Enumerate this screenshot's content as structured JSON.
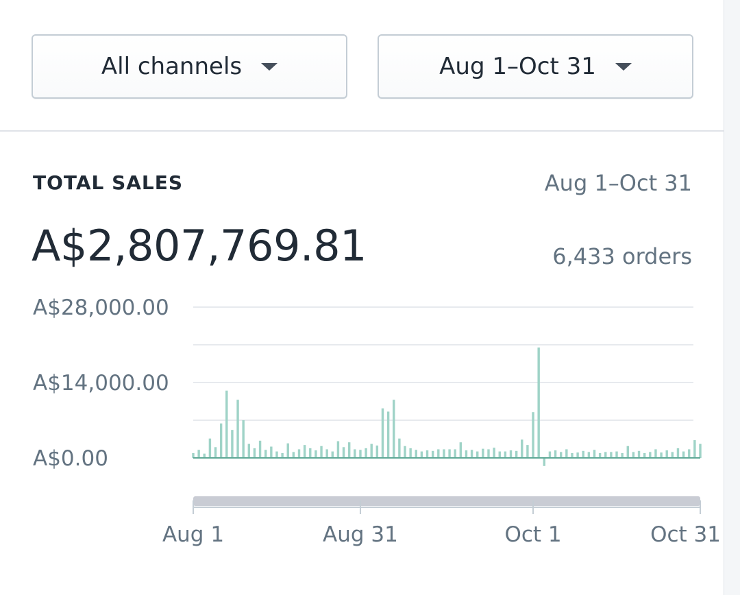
{
  "filters": {
    "channels_label": "All channels",
    "date_label": "Aug 1–Oct 31"
  },
  "card": {
    "title": "TOTAL SALES",
    "range": "Aug 1–Oct 31",
    "total": "A$2,807,769.81",
    "orders": "6,433 orders"
  },
  "colors": {
    "bar": "#9fd3c7",
    "bar_dark": "#5fa896",
    "grid": "#dfe3e8",
    "axis": "#c4cdd5"
  },
  "chart_data": {
    "type": "bar",
    "title": "",
    "xlabel": "",
    "ylabel": "",
    "y_ticks": [
      {
        "value": 28000,
        "label": "A$28,000.00"
      },
      {
        "value": 14000,
        "label": "A$14,000.00"
      },
      {
        "value": 0,
        "label": "A$0.00"
      }
    ],
    "ylim": [
      -4000,
      28000
    ],
    "x_ticks": [
      {
        "day_index": 0,
        "label": "Aug 1"
      },
      {
        "day_index": 30,
        "label": "Aug 31"
      },
      {
        "day_index": 61,
        "label": "Oct 1"
      },
      {
        "day_index": 91,
        "label": "Oct 31"
      }
    ],
    "categories": [
      "Aug 1",
      "Aug 2",
      "Aug 3",
      "Aug 4",
      "Aug 5",
      "Aug 6",
      "Aug 7",
      "Aug 8",
      "Aug 9",
      "Aug 10",
      "Aug 11",
      "Aug 12",
      "Aug 13",
      "Aug 14",
      "Aug 15",
      "Aug 16",
      "Aug 17",
      "Aug 18",
      "Aug 19",
      "Aug 20",
      "Aug 21",
      "Aug 22",
      "Aug 23",
      "Aug 24",
      "Aug 25",
      "Aug 26",
      "Aug 27",
      "Aug 28",
      "Aug 29",
      "Aug 30",
      "Aug 31",
      "Sep 1",
      "Sep 2",
      "Sep 3",
      "Sep 4",
      "Sep 5",
      "Sep 6",
      "Sep 7",
      "Sep 8",
      "Sep 9",
      "Sep 10",
      "Sep 11",
      "Sep 12",
      "Sep 13",
      "Sep 14",
      "Sep 15",
      "Sep 16",
      "Sep 17",
      "Sep 18",
      "Sep 19",
      "Sep 20",
      "Sep 21",
      "Sep 22",
      "Sep 23",
      "Sep 24",
      "Sep 25",
      "Sep 26",
      "Sep 27",
      "Sep 28",
      "Sep 29",
      "Sep 30",
      "Oct 1",
      "Oct 2",
      "Oct 3",
      "Oct 4",
      "Oct 5",
      "Oct 6",
      "Oct 7",
      "Oct 8",
      "Oct 9",
      "Oct 10",
      "Oct 11",
      "Oct 12",
      "Oct 13",
      "Oct 14",
      "Oct 15",
      "Oct 16",
      "Oct 17",
      "Oct 18",
      "Oct 19",
      "Oct 20",
      "Oct 21",
      "Oct 22",
      "Oct 23",
      "Oct 24",
      "Oct 25",
      "Oct 26",
      "Oct 27",
      "Oct 28",
      "Oct 29",
      "Oct 30",
      "Oct 31"
    ],
    "values": [
      900,
      1500,
      800,
      3600,
      2000,
      6400,
      12500,
      5200,
      10800,
      7000,
      2600,
      1800,
      3200,
      1500,
      2100,
      1200,
      900,
      2700,
      1100,
      1600,
      2400,
      1800,
      1400,
      2200,
      1600,
      1200,
      3100,
      2000,
      2900,
      1600,
      1500,
      1800,
      2600,
      2300,
      9200,
      8600,
      10800,
      3600,
      2200,
      1800,
      1500,
      1200,
      1400,
      1300,
      1600,
      1600,
      1600,
      1600,
      2900,
      1400,
      1500,
      1200,
      1700,
      1600,
      1900,
      1200,
      1200,
      1400,
      1300,
      3400,
      2400,
      8500,
      20500,
      -1500,
      1200,
      1400,
      1100,
      1600,
      900,
      1000,
      1300,
      1100,
      1500,
      900,
      1100,
      1100,
      1200,
      900,
      2200,
      1100,
      1300,
      900,
      1100,
      1600,
      1000,
      1400,
      1100,
      1800,
      1200,
      1600,
      3300,
      2600
    ],
    "grid": true,
    "legend": "none"
  }
}
